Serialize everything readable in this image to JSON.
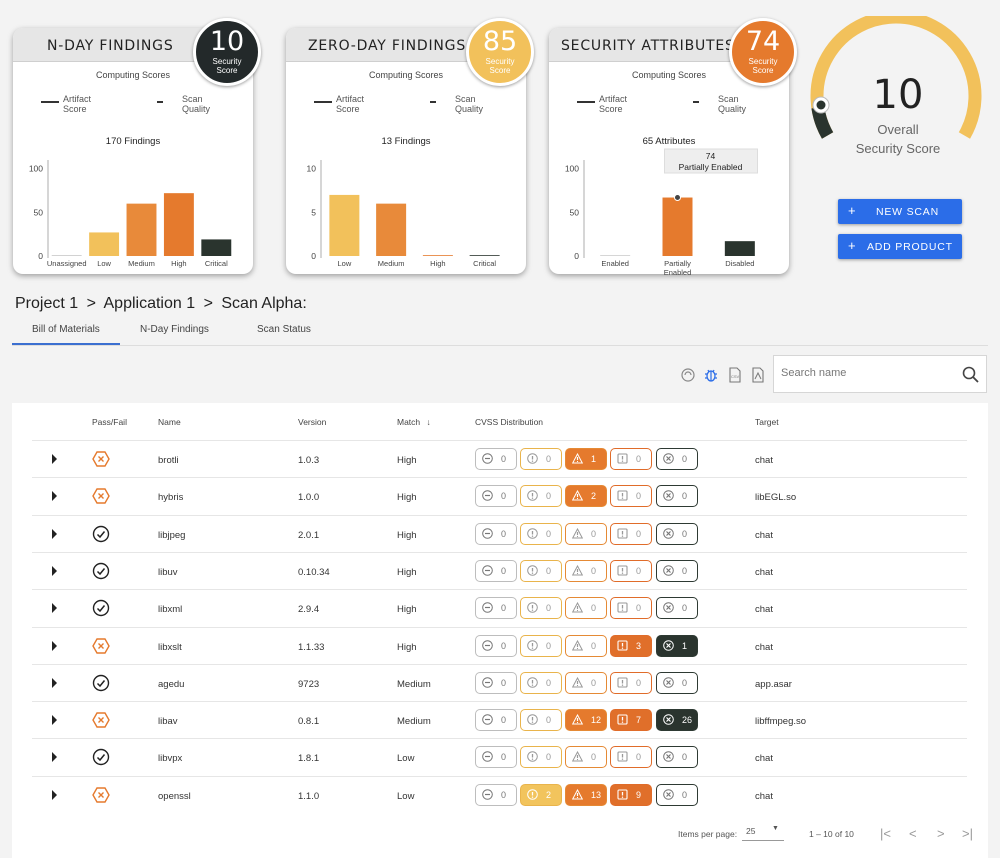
{
  "cards": [
    {
      "title": "N-DAY FINDINGS",
      "score": "10",
      "score_label": "Security Score",
      "score_color": "#23292a",
      "computing": "Computing Scores",
      "legend": [
        "Artifact Score",
        "Scan Quality"
      ],
      "chart_title": "170 Findings"
    },
    {
      "title": "ZERO-DAY FINDINGS",
      "score": "85",
      "score_label": "Security Score",
      "score_color": "#f2c15b",
      "computing": "Computing Scores",
      "legend": [
        "Artifact Score",
        "Scan Quality"
      ],
      "chart_title": "13 Findings"
    },
    {
      "title": "SECURITY ATTRIBUTES",
      "score": "74",
      "score_label": "Security Score",
      "score_color": "#e57a2d",
      "computing": "Computing Scores",
      "legend": [
        "Artifact Score",
        "Scan Quality"
      ],
      "chart_title": "65 Attributes",
      "tooltip_value": "74",
      "tooltip_label": "Partially Enabled"
    }
  ],
  "chart_data": [
    {
      "type": "bar",
      "title": "170 Findings",
      "categories": [
        "Unassigned",
        "Low",
        "Medium",
        "High",
        "Critical"
      ],
      "values": [
        1,
        27,
        60,
        72,
        19
      ],
      "yticks": [
        0,
        50,
        100
      ],
      "ylim": [
        0,
        110
      ],
      "colors": [
        "#cccccc",
        "#f2c15b",
        "#e88a3a",
        "#e57a2d",
        "#2a342e"
      ]
    },
    {
      "type": "bar",
      "title": "13 Findings",
      "categories": [
        "Low",
        "Medium",
        "High",
        "Critical"
      ],
      "values": [
        7,
        6,
        0.05,
        0.05
      ],
      "yticks": [
        0,
        5,
        10
      ],
      "ylim": [
        0,
        11
      ],
      "colors": [
        "#f2c15b",
        "#e88a3a",
        "#e57a2d",
        "#2a342e"
      ]
    },
    {
      "type": "bar",
      "title": "65 Attributes",
      "categories": [
        "Enabled",
        "Partially Enabled",
        "Disabled"
      ],
      "values": [
        0,
        67,
        17
      ],
      "yticks": [
        0,
        50,
        100
      ],
      "ylim": [
        0,
        110
      ],
      "colors": [
        "#cccccc",
        "#e57a2d",
        "#2a342e"
      ]
    }
  ],
  "overall": {
    "score": "10",
    "label_line1": "Overall",
    "label_line2": "Security Score",
    "fill_fraction": 0.1,
    "track_color": "#f2c15b",
    "fill_color": "#2a342e"
  },
  "buttons": {
    "new_scan": "NEW SCAN",
    "add_product": "ADD PRODUCT"
  },
  "breadcrumb": [
    "Project 1",
    ">",
    "Application 1",
    ">",
    "Scan Alpha:"
  ],
  "tabs": [
    "Bill of Materials",
    "N-Day Findings",
    "Scan Status"
  ],
  "search": {
    "placeholder": "Search name"
  },
  "table": {
    "headers": [
      "Pass/Fail",
      "Name",
      "Version",
      "Match",
      "CVSS Distribution",
      "Target"
    ],
    "rows": [
      {
        "status": "fail",
        "name": "brotli",
        "version": "1.0.3",
        "match": "High",
        "cvss": [
          0,
          0,
          1,
          0,
          0
        ],
        "target": "chat"
      },
      {
        "status": "fail",
        "name": "hybris",
        "version": "1.0.0",
        "match": "High",
        "cvss": [
          0,
          0,
          2,
          0,
          0
        ],
        "target": "libEGL.so"
      },
      {
        "status": "pass",
        "name": "libjpeg",
        "version": "2.0.1",
        "match": "High",
        "cvss": [
          0,
          0,
          0,
          0,
          0
        ],
        "target": "chat"
      },
      {
        "status": "pass",
        "name": "libuv",
        "version": "0.10.34",
        "match": "High",
        "cvss": [
          0,
          0,
          0,
          0,
          0
        ],
        "target": "chat"
      },
      {
        "status": "pass",
        "name": "libxml",
        "version": "2.9.4",
        "match": "High",
        "cvss": [
          0,
          0,
          0,
          0,
          0
        ],
        "target": "chat"
      },
      {
        "status": "fail",
        "name": "libxslt",
        "version": "1.1.33",
        "match": "High",
        "cvss": [
          0,
          0,
          0,
          3,
          1
        ],
        "target": "chat"
      },
      {
        "status": "pass",
        "name": "agedu",
        "version": "9723",
        "match": "Medium",
        "cvss": [
          0,
          0,
          0,
          0,
          0
        ],
        "target": "app.asar"
      },
      {
        "status": "fail",
        "name": "libav",
        "version": "0.8.1",
        "match": "Medium",
        "cvss": [
          0,
          0,
          12,
          7,
          26
        ],
        "target": "libffmpeg.so"
      },
      {
        "status": "pass",
        "name": "libvpx",
        "version": "1.8.1",
        "match": "Low",
        "cvss": [
          0,
          0,
          0,
          0,
          0
        ],
        "target": "chat"
      },
      {
        "status": "fail",
        "name": "openssl",
        "version": "1.1.0",
        "match": "Low",
        "cvss": [
          0,
          2,
          13,
          9,
          0
        ],
        "target": "chat"
      }
    ]
  },
  "pagination": {
    "items_per_page_label": "Items per page:",
    "items_per_page": "25",
    "range": "1 – 10 of 10"
  }
}
